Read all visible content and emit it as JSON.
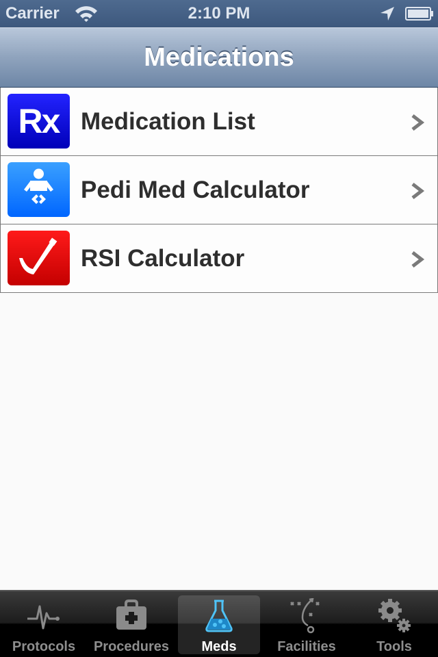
{
  "status_bar": {
    "carrier": "Carrier",
    "time": "2:10 PM",
    "icons": [
      "wifi-icon",
      "location-icon",
      "battery-icon"
    ]
  },
  "nav_bar": {
    "title": "Medications"
  },
  "list": {
    "items": [
      {
        "label": "Medication List",
        "icon": "rx-icon",
        "icon_text": "Rx",
        "icon_color": "#1a1aee"
      },
      {
        "label": "Pedi Med Calculator",
        "icon": "baby-icon",
        "icon_color": "#1e88ff"
      },
      {
        "label": "RSI Calculator",
        "icon": "laryngoscope-icon",
        "icon_color": "#e80000"
      }
    ]
  },
  "tab_bar": {
    "active_index": 2,
    "active_color": "#4fc3f7",
    "tabs": [
      {
        "label": "Protocols",
        "icon": "heartbeat-icon"
      },
      {
        "label": "Procedures",
        "icon": "medical-kit-icon"
      },
      {
        "label": "Meds",
        "icon": "flask-icon"
      },
      {
        "label": "Facilities",
        "icon": "play-diagram-icon"
      },
      {
        "label": "Tools",
        "icon": "gears-icon"
      }
    ]
  }
}
